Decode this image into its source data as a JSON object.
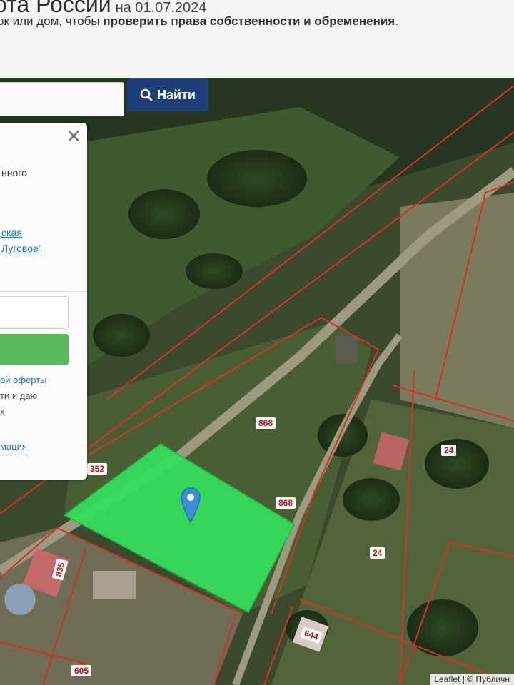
{
  "header": {
    "title": "ота России",
    "date": "на 01.07.2024",
    "subtitle_start": "ок или дом, чтобы ",
    "subtitle_bold": "проверить права собственности и обременения",
    "subtitle_end": "."
  },
  "search": {
    "button_label": "Найти",
    "input_value": ""
  },
  "popup": {
    "text_fragment": "нного",
    "link_line1": "ская",
    "link_line2": "Луговое\"",
    "terms_line1": "ой оферты",
    "terms_line2": "ти и даю",
    "terms_line3": "х",
    "info_link": "мация"
  },
  "map": {
    "parcel_labels": [
      "868",
      "868",
      "352",
      "24",
      "24",
      "835",
      "644",
      "605"
    ],
    "highlight_color": "#33e05a",
    "boundary_color": "#d6302a",
    "attribution": "Leaflet | © Публичн"
  }
}
